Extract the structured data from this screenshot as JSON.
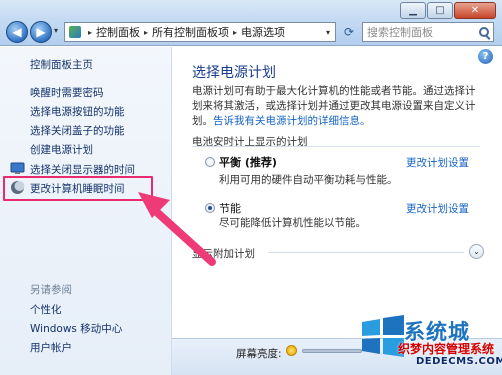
{
  "window": {
    "minimize_glyph": "▁",
    "maximize_glyph": "□",
    "close_glyph": "✕"
  },
  "toolbar": {
    "back_glyph": "◀",
    "forward_glyph": "▶",
    "recent_glyph": "▾",
    "refresh_glyph": "⟳"
  },
  "breadcrumb": {
    "items": [
      "控制面板",
      "所有控制面板项",
      "电源选项"
    ],
    "separator": "▸",
    "dropdown_glyph": "▾"
  },
  "search": {
    "placeholder": "搜索控制面板"
  },
  "sidebar": {
    "home": "控制面板主页",
    "items": [
      "唤醒时需要密码",
      "选择电源按钮的功能",
      "选择关闭盖子的功能",
      "创建电源计划",
      "选择关闭显示器的时间",
      "更改计算机睡眠时间"
    ],
    "see_also_title": "另请参阅",
    "see_also": [
      "个性化",
      "Windows 移动中心",
      "用户帐户"
    ]
  },
  "main": {
    "help_glyph": "?",
    "title": "选择电源计划",
    "description": "电源计划可有助于最大化计算机的性能或者节能。通过选择计划来将其激活，或选择计划并通过更改其电源设置来自定义计划。",
    "description_link": "告诉我有关电源计划的详细信息。",
    "section_label": "电池安时计上显示的计划",
    "plans": [
      {
        "name": "平衡 (推荐)",
        "desc": "利用可用的硬件自动平衡功耗与性能。",
        "link": "更改计划设置",
        "selected": false
      },
      {
        "name": "节能",
        "desc": "尽可能降低计算机性能以节能。",
        "link": "更改计划设置",
        "selected": true
      }
    ],
    "more_plans": "显示附加计划",
    "expand_glyph": "⌄"
  },
  "footer": {
    "brightness_label": "屏幕亮度:"
  },
  "watermark": {
    "brand": "系统城",
    "line1": "织梦内容管理系统",
    "line2": "DEDECMS.COM",
    "colors": {
      "brand": "#1e73be",
      "line1": "#d40000",
      "line2": "#0b2a6e"
    }
  },
  "colors": {
    "highlight": "#e92a6f",
    "arrow": "#ee3b78",
    "link": "#1563c5",
    "title": "#1a3d8f"
  }
}
